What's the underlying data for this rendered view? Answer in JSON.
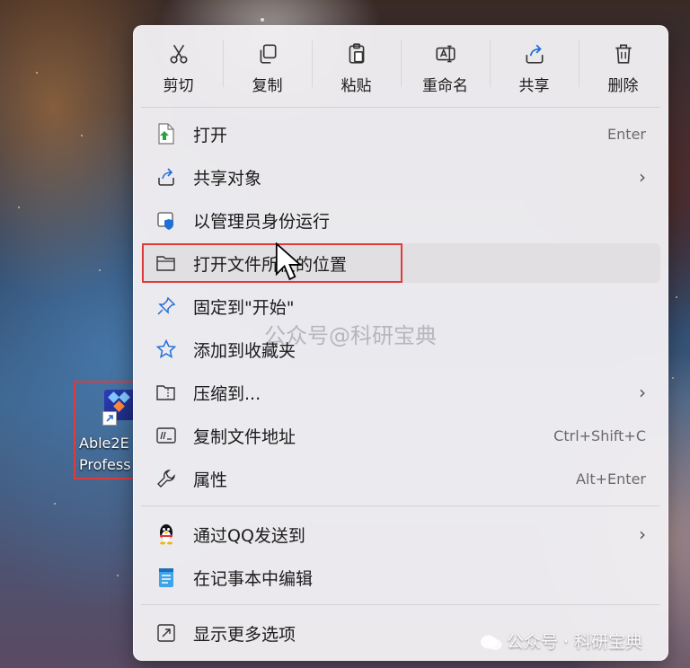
{
  "toolbar": [
    {
      "label": "剪切",
      "icon": "scissors-icon"
    },
    {
      "label": "复制",
      "icon": "copy-icon"
    },
    {
      "label": "粘贴",
      "icon": "paste-icon"
    },
    {
      "label": "重命名",
      "icon": "rename-icon"
    },
    {
      "label": "共享",
      "icon": "share-icon"
    },
    {
      "label": "删除",
      "icon": "trash-icon"
    }
  ],
  "items": [
    {
      "label": "打开",
      "shortcut": "Enter",
      "icon": "open-file-icon"
    },
    {
      "label": "共享对象",
      "arrow": "›",
      "icon": "share-icon"
    },
    {
      "label": "以管理员身份运行",
      "icon": "shield-icon"
    },
    {
      "label": "打开文件所在的位置",
      "icon": "folder-icon"
    },
    {
      "label": "固定到\"开始\"",
      "icon": "pin-icon"
    },
    {
      "label": "添加到收藏夹",
      "icon": "star-icon"
    },
    {
      "label": "压缩到...",
      "arrow": "›",
      "icon": "zip-folder-icon"
    },
    {
      "label": "复制文件地址",
      "shortcut": "Ctrl+Shift+C",
      "icon": "copy-path-icon"
    },
    {
      "label": "属性",
      "shortcut": "Alt+Enter",
      "icon": "wrench-icon"
    },
    {
      "label": "通过QQ发送到",
      "arrow": "›",
      "icon": "qq-penguin-icon"
    },
    {
      "label": "在记事本中编辑",
      "icon": "notepad-icon"
    },
    {
      "label": "显示更多选项",
      "icon": "more-options-icon"
    }
  ],
  "desktop_icon": {
    "line1": "Able2E",
    "line2": "Profess"
  },
  "watermark": "公众号@科研宝典",
  "wechat_mark": "公众号 · 科研宝典",
  "colors": {
    "highlight_box": "#e03b3b",
    "menu_bg": "#f1eef2"
  }
}
